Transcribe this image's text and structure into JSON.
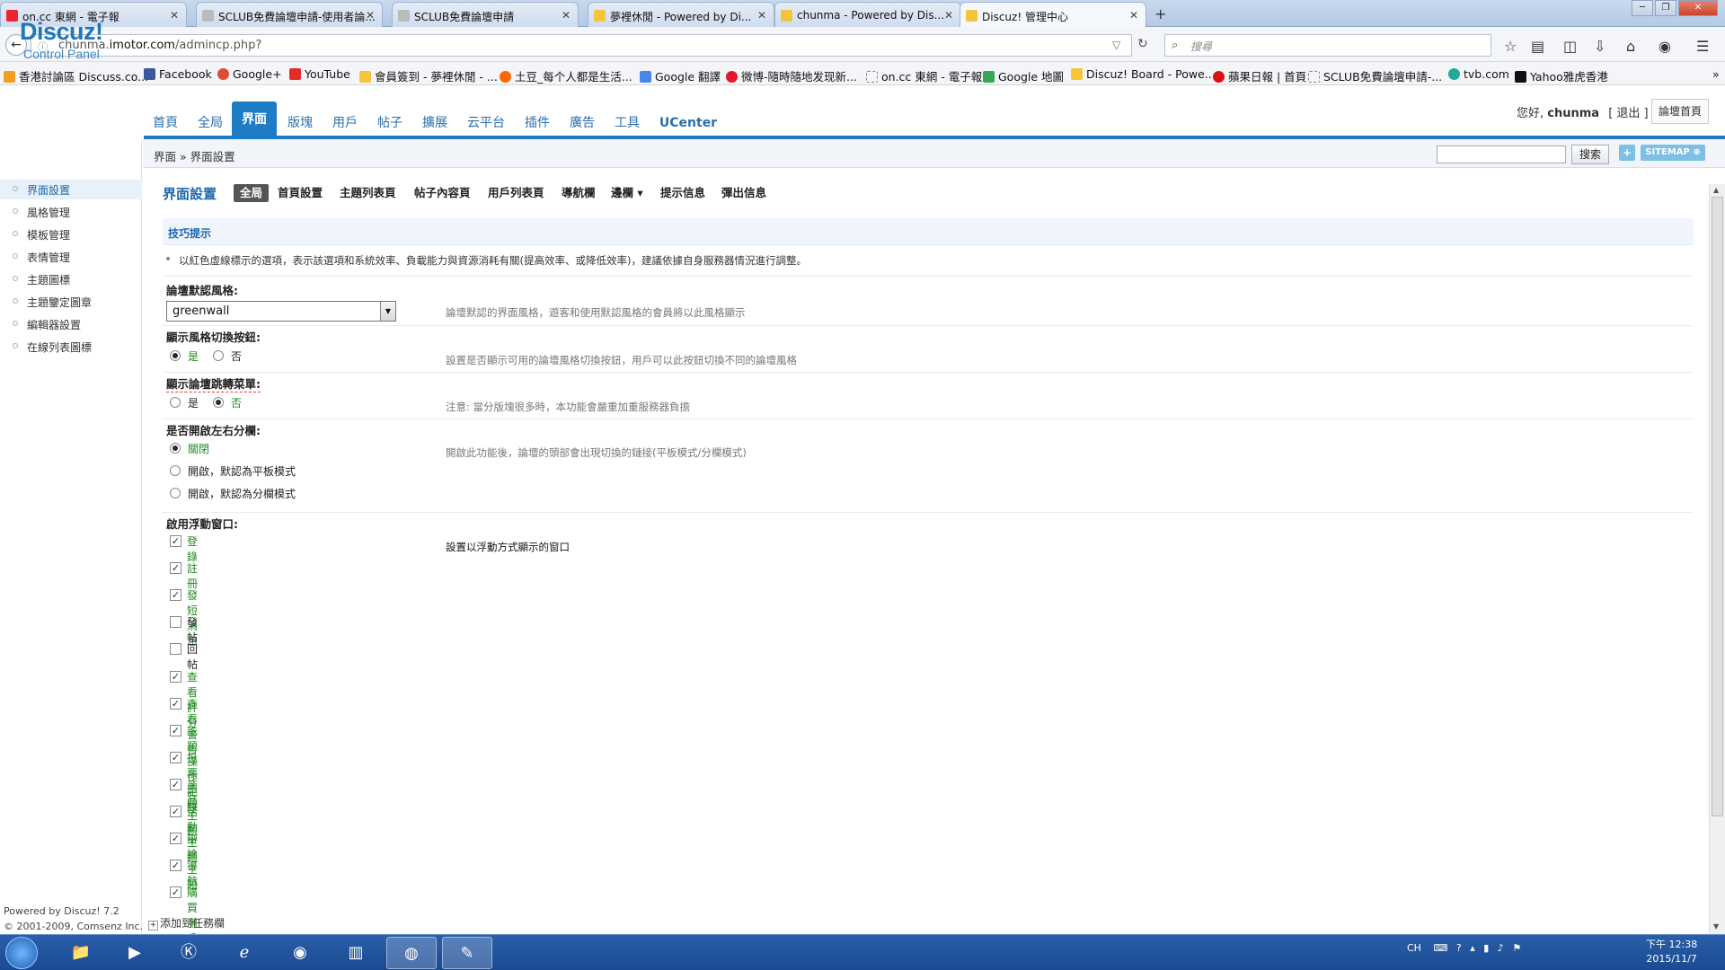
{
  "browser": {
    "tabs": [
      {
        "title": "on.cc 東網 - 電子報"
      },
      {
        "title": "SCLUB免費論壇申請-使用者論..."
      },
      {
        "title": "SCLUB免費論壇申請"
      },
      {
        "title": "夢裡休閒 - Powered by Di..."
      },
      {
        "title": "chunma - Powered by Dis..."
      },
      {
        "title": "Discuz! 管理中心"
      }
    ],
    "url": "chunma.imotor.com/admincp.php?",
    "url_host": "chunma.",
    "url_bold": "imotor.com",
    "url_path": "/admincp.php?",
    "search_placeholder": "搜尋",
    "bookmarks": [
      "香港討論區 Discuss.co...",
      "Facebook",
      "Google+",
      "YouTube",
      "會員簽到 - 夢裡休閒 - ...",
      "土豆_每个人都是生活...",
      "Google 翻譯",
      "微博-隨時隨地发现新...",
      "on.cc 東網 - 電子報",
      "Google 地圖",
      "Discuz! Board - Powe...",
      "蘋果日報 | 首頁",
      "SCLUB免費論壇申請-...",
      "tvb.com",
      "Yahoo雅虎香港"
    ]
  },
  "header": {
    "logo_text": "Discuz!",
    "logo_sub": "Control Panel",
    "nav": [
      "首頁",
      "全局",
      "界面",
      "版塊",
      "用戶",
      "帖子",
      "擴展",
      "云平台",
      "插件",
      "廣告",
      "工具",
      "UCenter"
    ],
    "active_nav": "界面",
    "greeting_prefix": "您好,",
    "username": "chunma",
    "logout": "[ 退出 ]",
    "forum_home": "論壇首頁"
  },
  "sidebar": {
    "items": [
      "界面設置",
      "風格管理",
      "模板管理",
      "表情管理",
      "主題圖標",
      "主題鑒定圖章",
      "編輯器設置",
      "在線列表圖標"
    ],
    "active": "界面設置",
    "powered_line1": "Powered by Discuz! 7.2",
    "powered_line2": "© 2001-2009, Comsenz Inc."
  },
  "breadcrumb": "界面 » 界面設置",
  "search_button": "搜索",
  "sitemap_button": "SITEMAP",
  "settings": {
    "title": "界面設置",
    "subtabs": [
      "全局",
      "首頁設置",
      "主題列表頁",
      "帖子內容頁",
      "用戶列表頁",
      "導航欄",
      "邊欄 ▾",
      "提示信息",
      "彈出信息"
    ],
    "active_subtab": "全局",
    "tips_title": "技巧提示",
    "tips_text": "以紅色虛線標示的選項，表示該選項和系統效率、負載能力與資源消耗有關(提高效率、或降低效率)，建議依據自身服務器情況進行調整。",
    "default_style_label": "論壇默認風格:",
    "default_style_value": "greenwall",
    "default_style_desc": "論壇默認的界面風格，遊客和使用默認風格的會員將以此風格顯示",
    "style_switch_label": "顯示風格切換按鈕:",
    "style_switch_yes": "是",
    "style_switch_no": "否",
    "style_switch_desc": "設置是否顯示可用的論壇風格切換按鈕，用戶可以此按鈕切換不同的論壇風格",
    "jump_menu_label": "顯示論壇跳轉菜單:",
    "jump_menu_yes": "是",
    "jump_menu_no": "否",
    "jump_menu_desc": "注意: 當分版塊很多時，本功能會嚴重加重服務器負擔",
    "split_label": "是否開啟左右分欄:",
    "split_options": [
      "關閉",
      "開啟，默認為平板模式",
      "開啟，默認為分欄模式"
    ],
    "split_desc": "開啟此功能後，論壇的頭部會出現切換的鏈接(平板模式/分欄模式)",
    "float_label": "啟用浮動窗口:",
    "float_desc": "設置以浮動方式顯示的窗口",
    "float_options": [
      {
        "label": "登錄",
        "checked": true
      },
      {
        "label": "註冊",
        "checked": true
      },
      {
        "label": "發短消息",
        "checked": true
      },
      {
        "label": "發帖",
        "checked": false
      },
      {
        "label": "回帖",
        "checked": false
      },
      {
        "label": "查看評分",
        "checked": true
      },
      {
        "label": "查看警告",
        "checked": true
      },
      {
        "label": "主題操作記錄",
        "checked": true
      },
      {
        "label": "投票主題",
        "checked": true
      },
      {
        "label": "商品主題",
        "checked": true
      },
      {
        "label": "活動主題",
        "checked": true
      },
      {
        "label": "辯論主題",
        "checked": true
      },
      {
        "label": "導航",
        "checked": true
      },
      {
        "label": "購買用戶組",
        "checked": true
      }
    ],
    "add_fav": "添加到任務欄"
  },
  "taskbar": {
    "tray_text": "CH",
    "time": "下午 12:38",
    "date": "2015/11/7"
  },
  "colors": {
    "accent": "#1d7cc4",
    "logo_orange": "#f58b0f",
    "green_label": "#1e8a1e"
  }
}
